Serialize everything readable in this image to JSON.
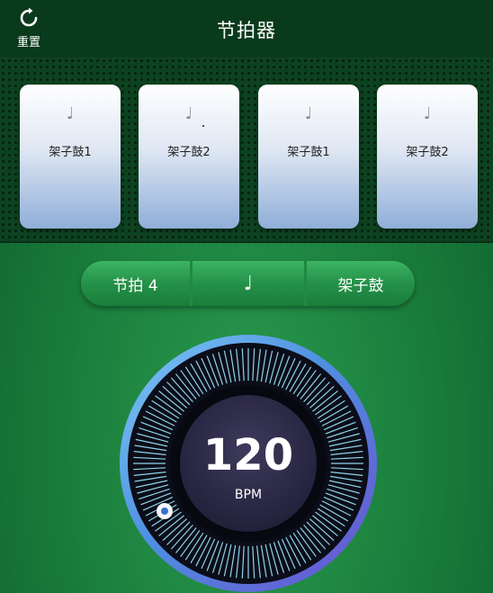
{
  "header": {
    "title": "节拍器",
    "reset_label": "重置",
    "reset_icon": "refresh-icon"
  },
  "pads": [
    {
      "note": "♩",
      "label": "架子鼓1"
    },
    {
      "note": "♩",
      "label": "架子鼓2"
    },
    {
      "note": "♩",
      "label": "架子鼓1"
    },
    {
      "note": "♩",
      "label": "架子鼓2"
    }
  ],
  "controls": {
    "beat_label": "节拍 4",
    "note_symbol": "♩",
    "instrument_label": "架子鼓"
  },
  "dial": {
    "bpm": "120",
    "unit": "BPM"
  },
  "colors": {
    "accent_blue": "#5bb4ee",
    "accent_purple": "#6a4fd0",
    "header_bg": "#0a3a1c"
  }
}
